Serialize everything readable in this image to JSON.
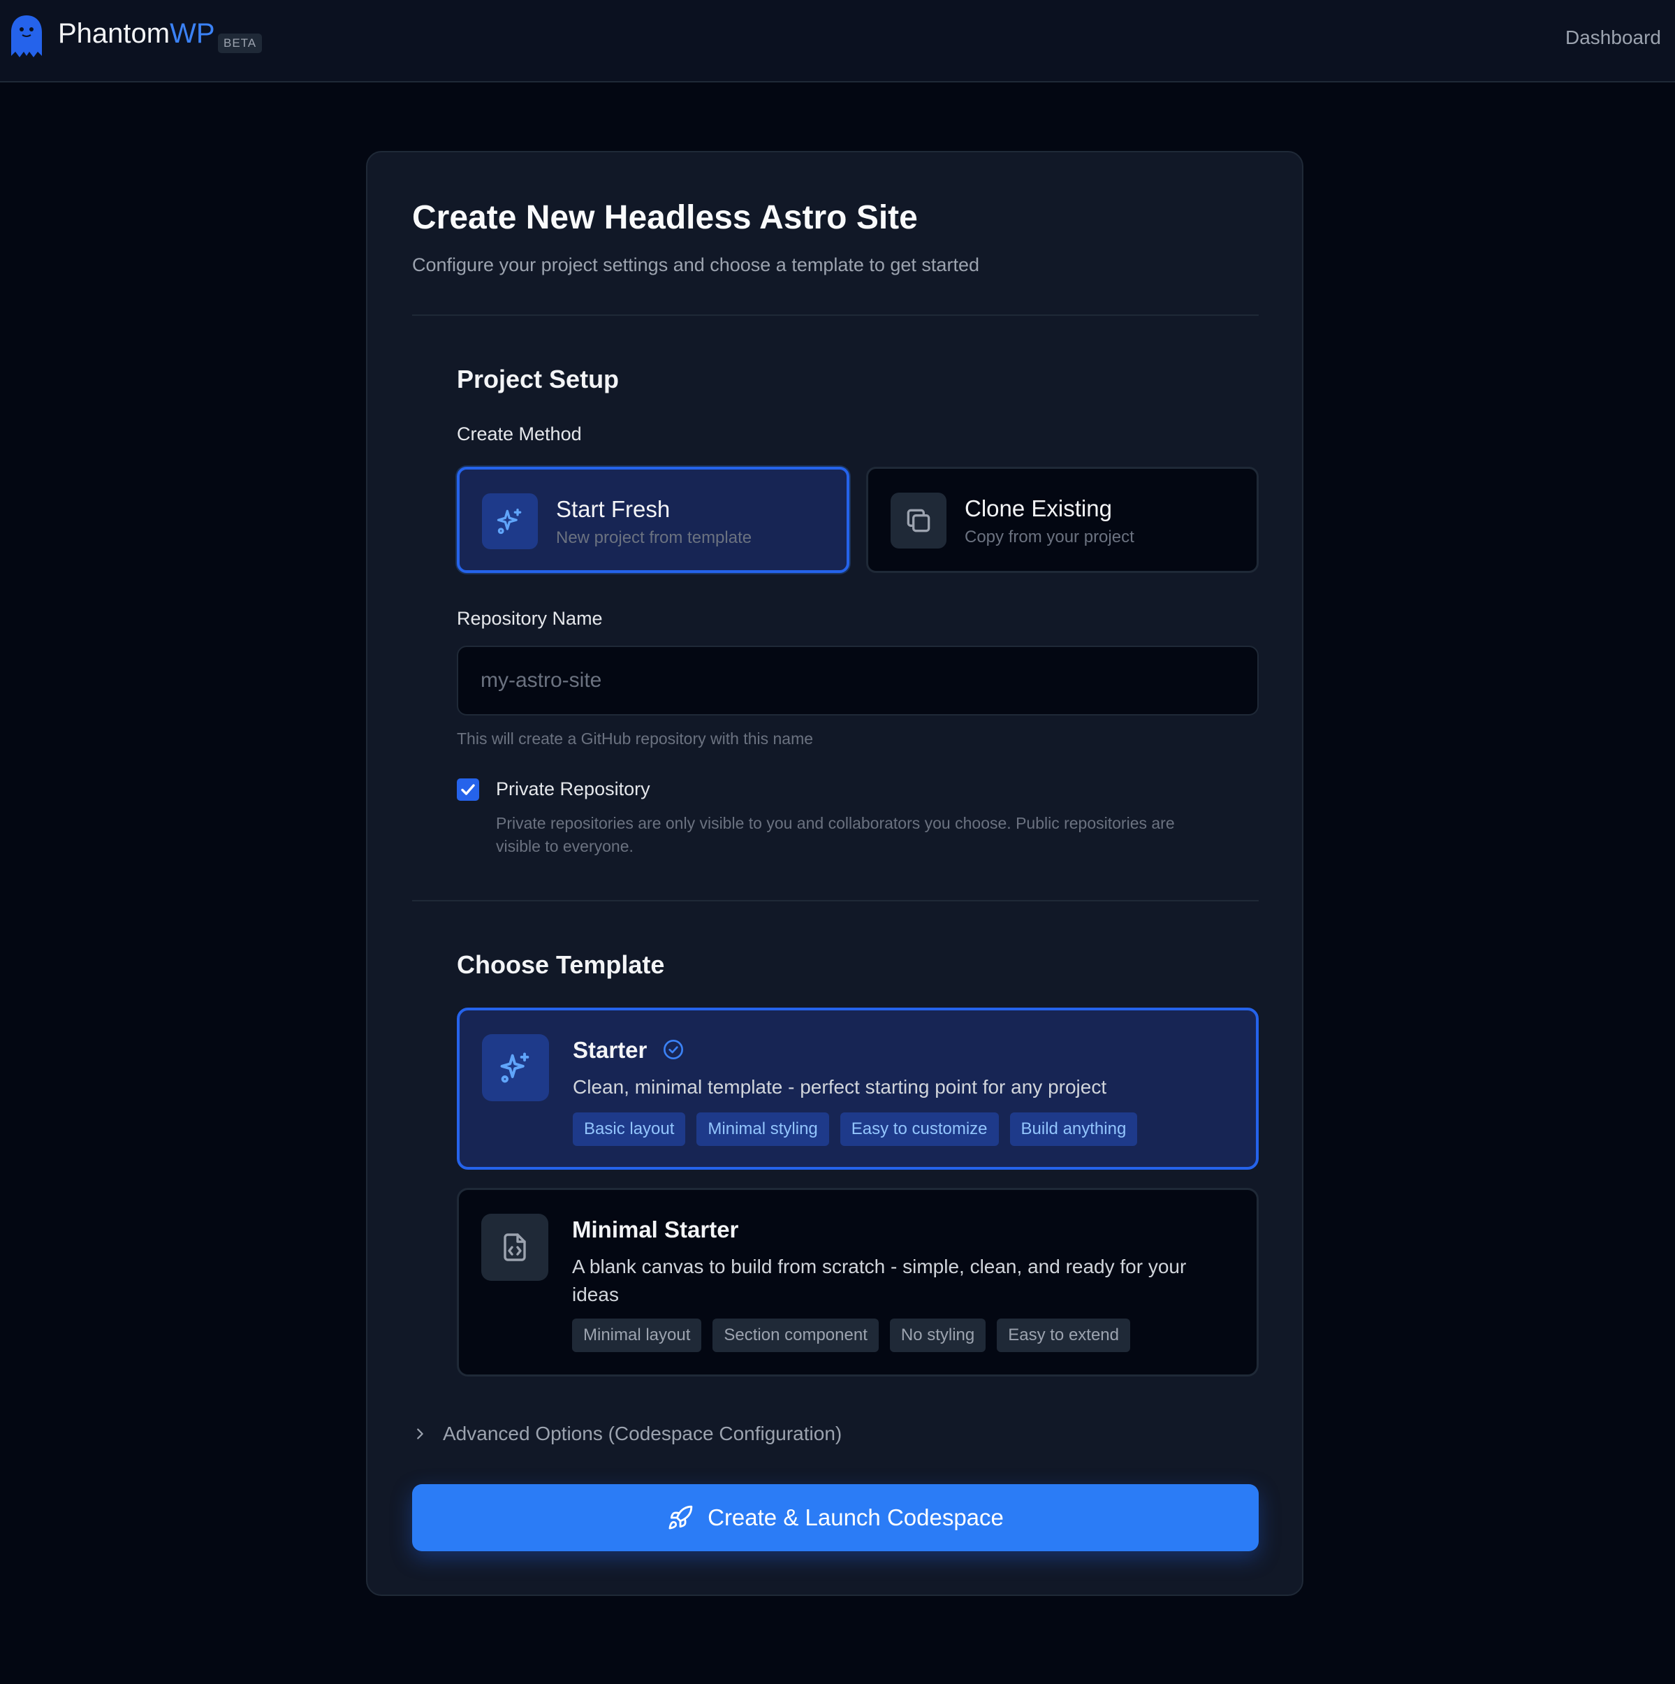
{
  "header": {
    "brand_main": "Phantom",
    "brand_accent": "WP",
    "badge": "BETA",
    "nav_dashboard": "Dashboard"
  },
  "page": {
    "title": "Create New Headless Astro Site",
    "subtitle": "Configure your project settings and choose a template to get started"
  },
  "project_setup": {
    "section_title": "Project Setup",
    "create_method_label": "Create Method",
    "methods": [
      {
        "title": "Start Fresh",
        "subtitle": "New project from template",
        "icon": "sparkles-icon",
        "selected": true
      },
      {
        "title": "Clone Existing",
        "subtitle": "Copy from your project",
        "icon": "copy-icon",
        "selected": false
      }
    ],
    "repo_label": "Repository Name",
    "repo_placeholder": "my-astro-site",
    "repo_value": "",
    "repo_hint": "This will create a GitHub repository with this name",
    "private_label": "Private Repository",
    "private_checked": true,
    "private_desc_line1": "Private repositories are only visible to you and collaborators you choose. Public repositories are",
    "private_desc_line2": "visible to everyone."
  },
  "templates": {
    "section_title": "Choose Template",
    "items": [
      {
        "name": "Starter",
        "selected": true,
        "icon": "sparkles-icon",
        "description": "Clean, minimal template - perfect starting point for any project",
        "tags": [
          "Basic layout",
          "Minimal styling",
          "Easy to customize",
          "Build anything"
        ]
      },
      {
        "name": "Minimal Starter",
        "selected": false,
        "icon": "file-code-icon",
        "description_line1": "A blank canvas to build from scratch - simple, clean, and ready for your",
        "description_line2": "ideas",
        "tags": [
          "Minimal layout",
          "Section component",
          "No styling",
          "Easy to extend"
        ]
      }
    ]
  },
  "advanced_options_label": "Advanced Options (Codespace Configuration)",
  "cta_label": "Create & Launch Codespace",
  "colors": {
    "accent": "#2563eb",
    "button": "#2b7cf6",
    "background": "#030712",
    "card": "#111827"
  }
}
